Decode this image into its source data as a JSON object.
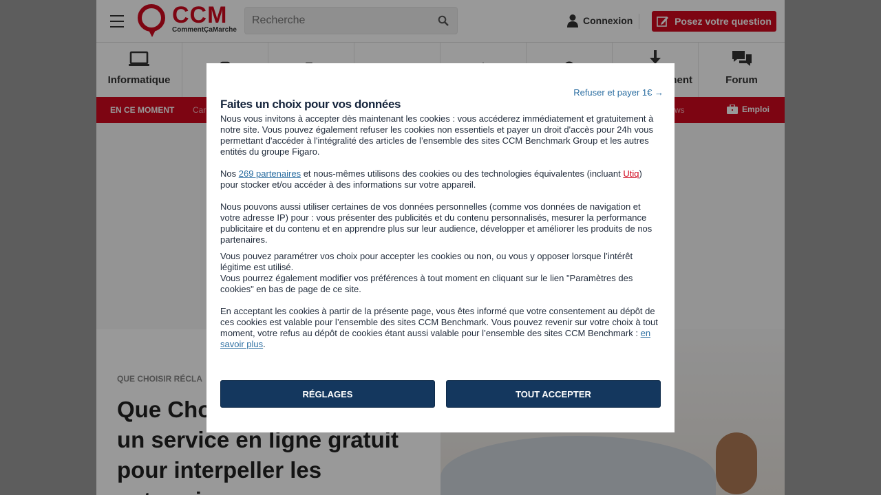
{
  "header": {
    "logo_name": "CCM",
    "logo_sub": "CommentÇaMarche",
    "search_placeholder": "Recherche",
    "login_label": "Connexion",
    "ask_label": "Posez votre question"
  },
  "categories": [
    {
      "label": "Informatique",
      "icon": "laptop-icon"
    },
    {
      "label": "",
      "icon": "phone-icon"
    },
    {
      "label": "",
      "icon": "devices-icon"
    },
    {
      "label": "",
      "icon": "camera-icon"
    },
    {
      "label": "",
      "icon": "home-wifi-icon"
    },
    {
      "label": "",
      "icon": "lock-icon"
    },
    {
      "label": "ment",
      "icon": "download-icon"
    },
    {
      "label": "Forum",
      "icon": "chat-icon"
    }
  ],
  "redbar": {
    "moment_label": "EN CE MOMENT",
    "item_partial_left": "Car",
    "item_partial_right": "ws",
    "emploi_label": "Emploi"
  },
  "article": {
    "kicker": "QUE CHOISIR RÉCLA",
    "headline": "Que Cho\nun service en ligne gratuit\npour interpeller les\nentreprises"
  },
  "modal": {
    "refuse_link": "Refuser et payer 1€ →",
    "title": "Faites un choix pour vos données",
    "p1": "Nous vous invitons à accepter dès maintenant les cookies : vous accéderez immédiatement et gratuitement à notre site. Vous pouvez également refuser les cookies non essentiels et payer un droit d'accès pour 24h vous permettant d'accéder à l'intégralité des articles de l’ensemble des sites CCM Benchmark Group et les autres entités du groupe Figaro.",
    "p2_a": "Nos ",
    "p2_link": "269 partenaires",
    "p2_b": " et nous-mêmes utilisons des cookies ou des technologies équivalentes (incluant ",
    "p2_utiq": "Utiq",
    "p2_c": ") pour stocker et/ou accéder à des informations sur votre appareil.",
    "p3": "Nous pouvons aussi utiliser certaines de vos données personnelles (comme vos données de navigation et votre adresse IP) pour : vous présenter des publicités et du contenu personnalisés, mesurer la performance publicitaire et du contenu et en apprendre plus sur leur audience, développer et améliorer les produits de nos partenaires.",
    "p4a": "Vous pouvez paramétrer vos choix pour accepter les cookies ou non, ou vous y opposer lorsque l’intérêt légitime est utilisé.",
    "p4b": "Vous pourrez également modifier vos préférences à tout moment en cliquant sur le lien \"Paramètres des cookies\" en bas de page de ce site.",
    "p5_a": "En acceptant les cookies à partir de la présente page, vous êtes informé que votre consentement au dépôt de ces cookies est valable pour l’ensemble des sites CCM Benchmark. Vous pouvez revenir sur votre choix à tout moment, votre refus au dépôt de cookies étant aussi valable pour l’ensemble des sites CCM Benchmark : ",
    "p5_link": "en savoir plus",
    "p5_b": ".",
    "settings_button": "RÉGLAGES",
    "accept_button": "TOUT ACCEPTER"
  },
  "colors": {
    "brand_red": "#d0091e",
    "button_navy": "#14375e",
    "link_blue": "#2d6fa2"
  }
}
